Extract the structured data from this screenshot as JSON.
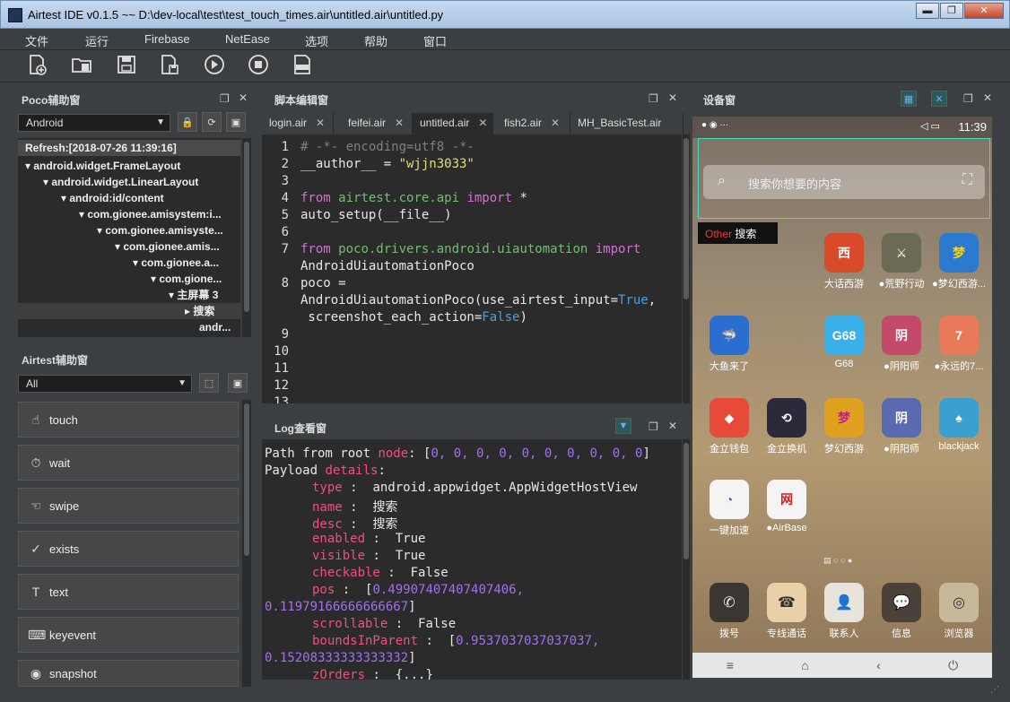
{
  "window": {
    "title": "Airtest IDE v0.1.5 ~~ D:\\dev-local\\test\\test_touch_times.air\\untitled.air\\untitled.py",
    "min": "▬",
    "max": "❐",
    "close": "✕"
  },
  "menu": [
    "文件",
    "运行",
    "Firebase",
    "NetEase",
    "选项",
    "帮助",
    "窗口"
  ],
  "toolbar": [
    {
      "icon": "new-file-icon"
    },
    {
      "icon": "open-folder-icon"
    },
    {
      "icon": "save-icon"
    },
    {
      "icon": "save-as-icon"
    },
    {
      "icon": "run-icon"
    },
    {
      "icon": "stop-icon"
    },
    {
      "icon": "log-icon",
      "label": "LOG"
    }
  ],
  "poco": {
    "title": "Poco辅助窗",
    "mode": "Android",
    "tree": [
      {
        "text": "Refresh:[2018-07-26 11:39:16]"
      },
      {
        "text": "▾ android.widget.FrameLayout"
      },
      {
        "text": "▾ android.widget.LinearLayout"
      },
      {
        "text": "▾ android:id/content"
      },
      {
        "text": "▾ com.gionee.amisystem:i..."
      },
      {
        "text": "▾ com.gionee.amisyste..."
      },
      {
        "text": "▾ com.gionee.amis..."
      },
      {
        "text": "▾ com.gionee.a..."
      },
      {
        "text": "▾ com.gione..."
      },
      {
        "text": "▾ 主屏幕 3"
      },
      {
        "text": "▸ 搜索"
      },
      {
        "text": "andr..."
      }
    ]
  },
  "airtest": {
    "title": "Airtest辅助窗",
    "filter": "All",
    "actions": [
      {
        "label": "touch",
        "icon": "☝"
      },
      {
        "label": "wait",
        "icon": "⏱"
      },
      {
        "label": "swipe",
        "icon": "☜"
      },
      {
        "label": "exists",
        "icon": "✓"
      },
      {
        "label": "text",
        "icon": "T"
      },
      {
        "label": "keyevent",
        "icon": "⌨"
      },
      {
        "label": "snapshot",
        "icon": "◉"
      }
    ]
  },
  "editor": {
    "title": "脚本编辑窗",
    "tabs": [
      "login.air",
      "feifei.air",
      "untitled.air",
      "fish2.air",
      "MH_BasicTest.air"
    ],
    "close": "✕",
    "line_numbers": [
      "1",
      "2",
      "3",
      "4",
      "5",
      "6",
      "7",
      "",
      "8",
      "",
      "",
      "9",
      "10",
      "11",
      "12",
      "13"
    ],
    "lines": {
      "l1": "# -*- encoding=utf8 -*-",
      "l2a": "__author__ = ",
      "l2b": "\"wjjn3033\"",
      "l4a": "from ",
      "l4b": "airtest.core.api ",
      "l4c": "import ",
      "l4d": "*",
      "l5": "auto_setup(__file__)",
      "l7a": "from ",
      "l7b": "poco.drivers.android.uiautomation ",
      "l7c": "import",
      "l7d": "AndroidUiautomationPoco",
      "l8a": "poco =",
      "l8b": "AndroidUiautomationPoco(use_airtest_input=",
      "l8c": "True",
      ",": ",",
      "l8d": " screenshot_each_action=",
      "l8e": "False",
      ")": ")"
    }
  },
  "log": {
    "title": "Log查看窗",
    "lines": {
      "p1": "Path from root ",
      "p2": "node",
      ": [": ": [",
      "p3": "0, 0, 0, 0, 0, 0, 0, 0, 0, 0",
      "p4": "]",
      "d1": "Payload ",
      "d2": "details",
      ":": ":",
      "k_type": "type",
      "v_type": "android.appwidget.AppWidgetHostView",
      "k_name": "name",
      "v_name": "搜索",
      "k_desc": "desc",
      "v_desc": "搜索",
      "k_enabled": "enabled",
      "v_enabled": "True",
      "k_visible": "visible",
      "v_visible": "True",
      "k_checkable": "checkable",
      "v_checkable": "False",
      "k_pos": "pos",
      "v_pos1": "0.49907407407407406,",
      "v_pos2": "0.11979166666666667",
      "k_scroll": "scrollable",
      "v_scroll": "False",
      "k_bounds": "boundsInParent",
      "v_bounds1": "0.9537037037037037,",
      "v_bounds2": "0.15208333333333332",
      "k_next": "zOrders",
      "v_next": "{...}"
    }
  },
  "device": {
    "title": "设备窗",
    "time": "11:39",
    "search_placeholder": "搜索你想要的内容",
    "overlay_type": "Other",
    "overlay_name": "搜索",
    "apps": [
      {
        "name": "大话西游",
        "bg": "#d84a2a",
        "glyph": "西"
      },
      {
        "name": "●荒野行动",
        "bg": "#6b6b55",
        "glyph": "⚔"
      },
      {
        "name": "●梦幻西游...",
        "bg": "#2a7ad0",
        "glyph": "梦"
      },
      {
        "name": "大鱼来了",
        "bg": "#2a6ed0",
        "glyph": "🦈"
      },
      {
        "name": "G68",
        "bg": "#3ab0e8",
        "glyph": "G68"
      },
      {
        "name": "●阴阳师",
        "bg": "#c44a6a",
        "glyph": "阴"
      },
      {
        "name": "●永远的7...",
        "bg": "#e87a5a",
        "glyph": "7"
      },
      {
        "name": "金立钱包",
        "bg": "#e84a3a",
        "glyph": "◆"
      },
      {
        "name": "金立换机",
        "bg": "#2a2a3a",
        "glyph": "⟲"
      },
      {
        "name": "梦幻西游",
        "bg": "#e0a020",
        "glyph": "梦"
      },
      {
        "name": "●阴阳师",
        "bg": "#5a6ab0",
        "glyph": "阴"
      },
      {
        "name": "blackjack",
        "bg": "#3aa0d0",
        "glyph": "♠"
      },
      {
        "name": "一键加速",
        "bg": "#f4f4f4",
        "glyph": "◔"
      },
      {
        "name": "●AirBase",
        "bg": "#f4f4f4",
        "glyph": "网"
      }
    ],
    "dock": [
      {
        "name": "拨号",
        "glyph": "✆"
      },
      {
        "name": "专线通话",
        "glyph": "☎"
      },
      {
        "name": "联系人",
        "glyph": "👤"
      },
      {
        "name": "信息",
        "glyph": "💬"
      },
      {
        "name": "浏览器",
        "glyph": "◎"
      }
    ],
    "nav": [
      "≡",
      "⌂",
      "‹",
      "⏻"
    ]
  }
}
